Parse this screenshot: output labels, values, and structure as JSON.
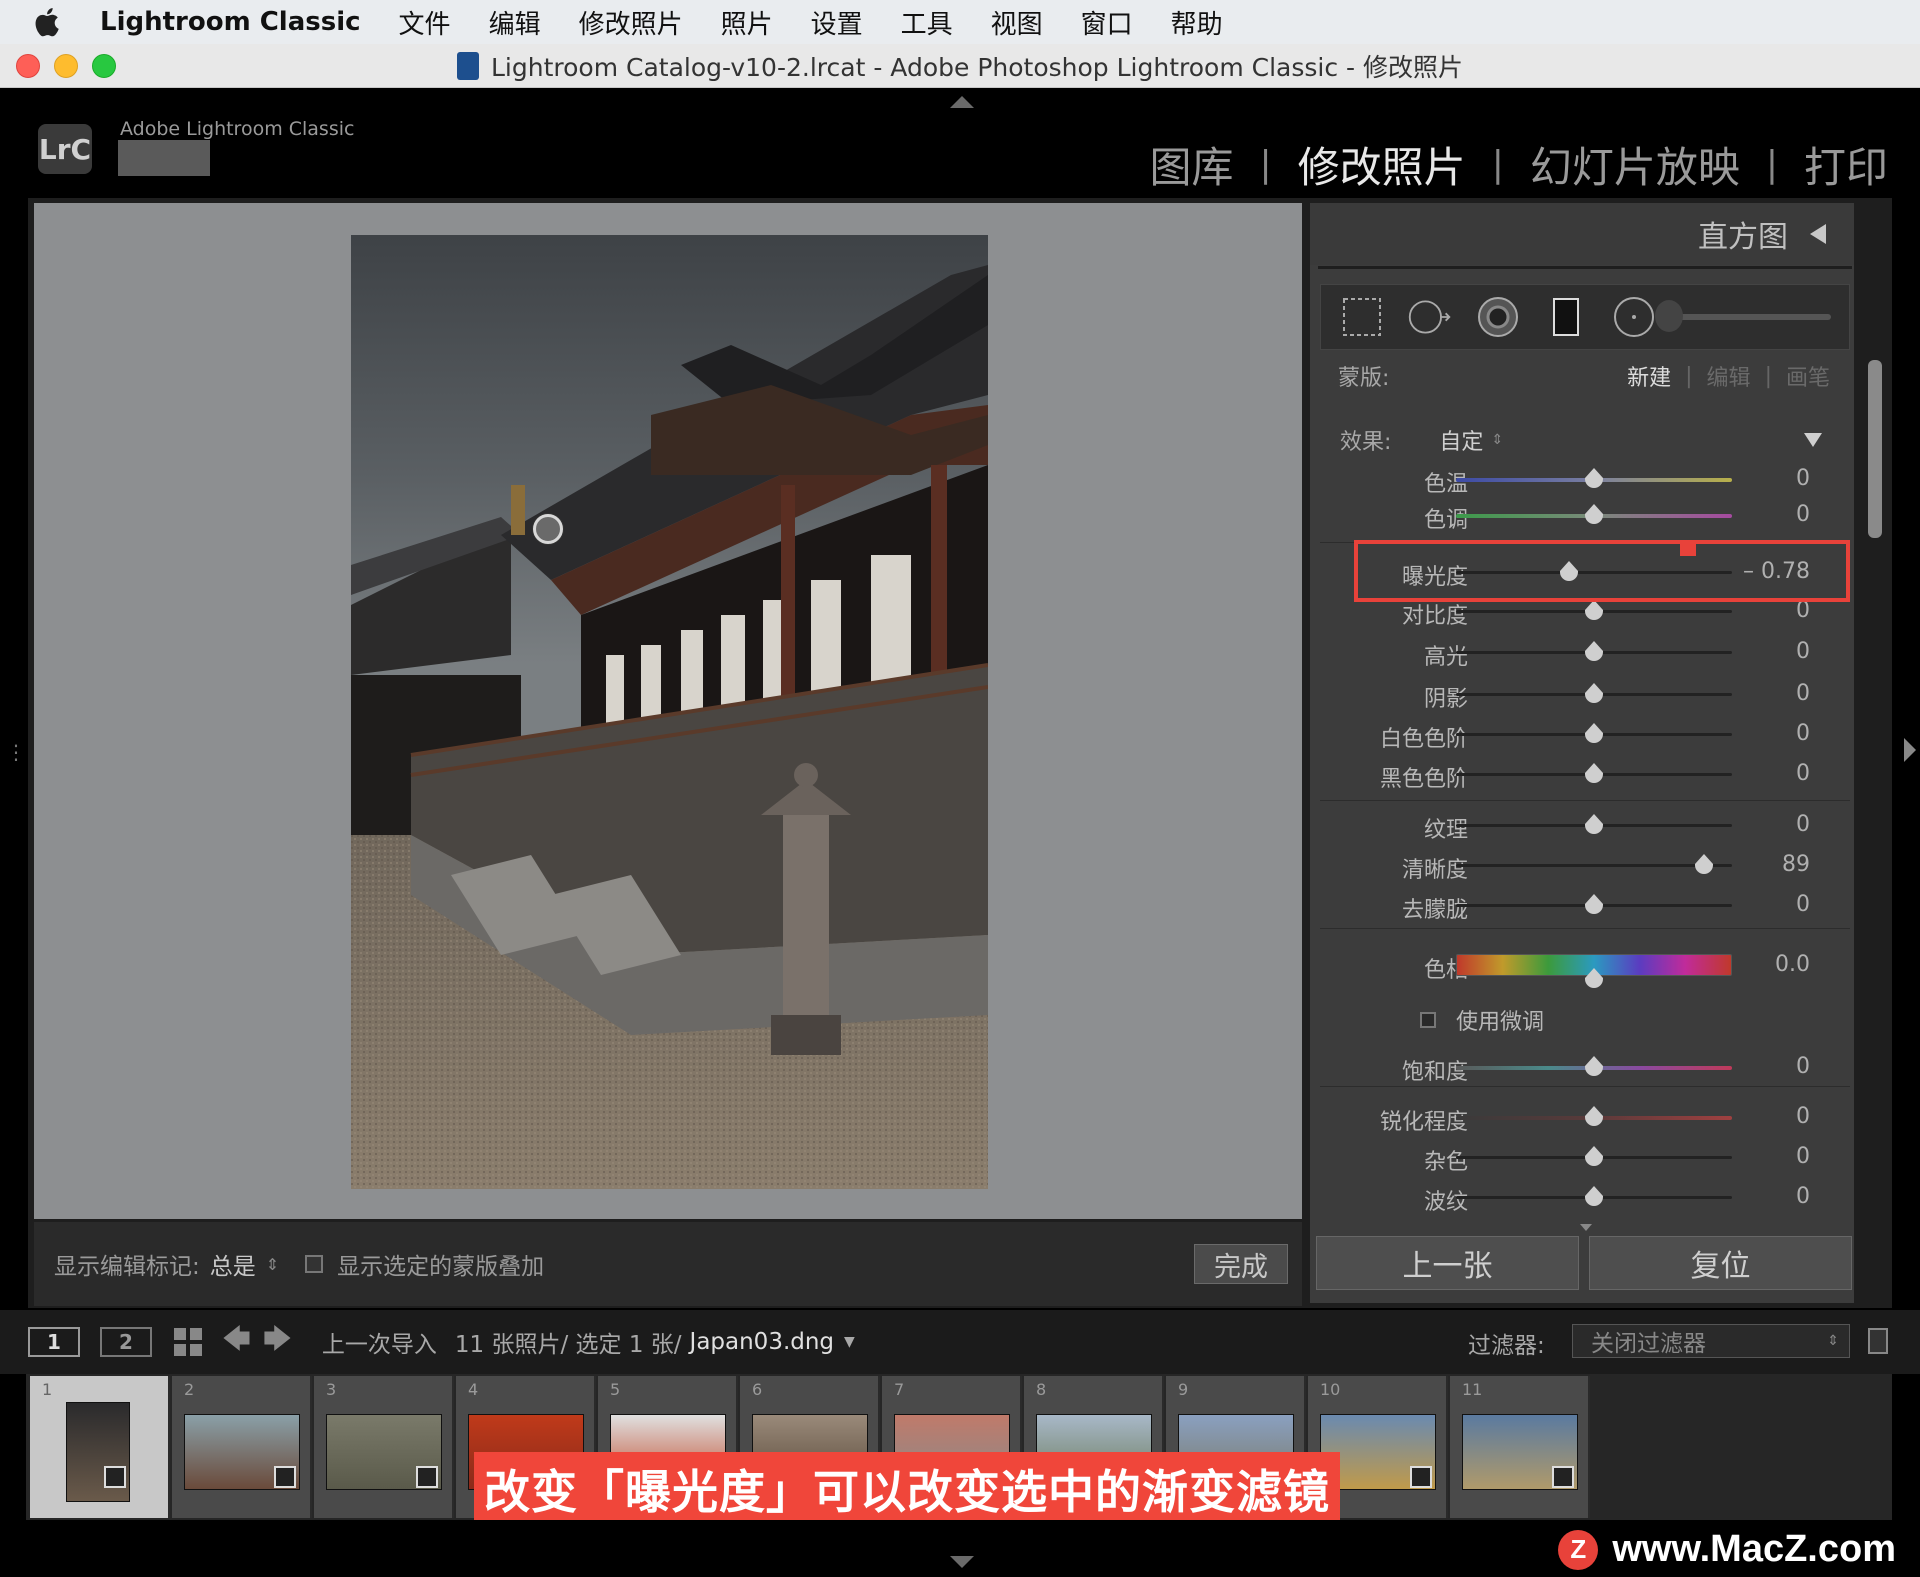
{
  "menubar": {
    "app_name": "Lightroom Classic",
    "items": [
      "文件",
      "编辑",
      "修改照片",
      "照片",
      "设置",
      "工具",
      "视图",
      "窗口",
      "帮助"
    ]
  },
  "window": {
    "title": "Lightroom Catalog-v10-2.lrcat - Adobe Photoshop Lightroom Classic - 修改照片"
  },
  "identity": {
    "logo": "LrC",
    "brand": "Adobe Lightroom Classic"
  },
  "modules": {
    "items": [
      "图库",
      "修改照片",
      "幻灯片放映",
      "打印"
    ],
    "separator": "|",
    "active_index": 1
  },
  "toolbar": {
    "show_marks_label": "显示编辑标记:",
    "show_marks_value": "总是",
    "overlay_label": "显示选定的蒙版叠加",
    "done_label": "完成"
  },
  "right_panel": {
    "histogram_label": "直方图",
    "mask_label": "蒙版:",
    "mask_new": "新建",
    "mask_edit": "编辑",
    "mask_brush": "画笔",
    "effect_label": "效果:",
    "effect_value": "自定",
    "sliders": [
      {
        "label": "色温",
        "value": "0",
        "pos": 0.5,
        "track": "temp"
      },
      {
        "label": "色调",
        "value": "0",
        "pos": 0.5,
        "track": "tint"
      },
      {
        "label": "曝光度",
        "value": "– 0.78",
        "pos": 0.41,
        "track": "plain"
      },
      {
        "label": "对比度",
        "value": "0",
        "pos": 0.5,
        "track": "plain"
      },
      {
        "label": "高光",
        "value": "0",
        "pos": 0.5,
        "track": "plain"
      },
      {
        "label": "阴影",
        "value": "0",
        "pos": 0.5,
        "track": "plain"
      },
      {
        "label": "白色色阶",
        "value": "0",
        "pos": 0.5,
        "track": "plain"
      },
      {
        "label": "黑色色阶",
        "value": "0",
        "pos": 0.5,
        "track": "plain"
      },
      {
        "label": "纹理",
        "value": "0",
        "pos": 0.5,
        "track": "plain"
      },
      {
        "label": "清晰度",
        "value": "89",
        "pos": 0.9,
        "track": "plain"
      },
      {
        "label": "去朦胧",
        "value": "0",
        "pos": 0.5,
        "track": "plain"
      },
      {
        "label": "色相",
        "value": "0.0",
        "pos": 0.5,
        "track": "hue"
      },
      {
        "label": "饱和度",
        "value": "0",
        "pos": 0.5,
        "track": "sat"
      },
      {
        "label": "锐化程度",
        "value": "0",
        "pos": 0.5,
        "track": "sharp"
      },
      {
        "label": "杂色",
        "value": "0",
        "pos": 0.5,
        "track": "plain"
      },
      {
        "label": "波纹",
        "value": "0",
        "pos": 0.5,
        "track": "plain"
      }
    ],
    "fine_tune_label": "使用微调",
    "prev_button": "上一张",
    "reset_button": "复位"
  },
  "filmstrip_header": {
    "screen1": "1",
    "screen2": "2",
    "source": "上一次导入",
    "count": "11 张照片/ 选定 1 张/",
    "filename": "Japan03.dng",
    "filter_label": "过滤器:",
    "filter_value": "关闭过滤器"
  },
  "filmstrip": {
    "numbers": [
      "1",
      "2",
      "3",
      "4",
      "5",
      "6",
      "7",
      "8",
      "9",
      "10",
      "11"
    ],
    "selected_index": 0
  },
  "caption": "改变「曝光度」可以改变选中的渐变滤镜",
  "watermark": {
    "logo": "Z",
    "text": "www.MacZ.com"
  },
  "colors": {
    "highlight": "#e8423a",
    "caption_bg": "#f0463a",
    "panel_bg": "#3c3c3c"
  }
}
